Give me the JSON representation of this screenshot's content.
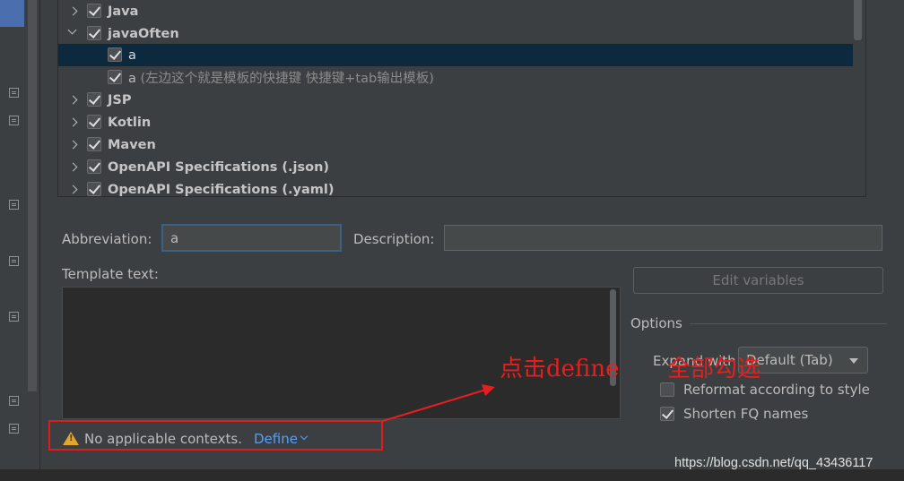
{
  "tree": {
    "rows": [
      {
        "label": "Java",
        "checked": true,
        "expanded": false,
        "level": 0
      },
      {
        "label": "javaOften",
        "checked": true,
        "expanded": true,
        "level": 0
      },
      {
        "label": "a",
        "checked": true,
        "level": 1,
        "selected": true
      },
      {
        "label": "a",
        "desc": " (左边这个就是模板的快捷键  快捷键+tab输出模板)",
        "checked": true,
        "level": 1
      },
      {
        "label": "JSP",
        "checked": true,
        "expanded": false,
        "level": 0
      },
      {
        "label": "Kotlin",
        "checked": true,
        "expanded": false,
        "level": 0
      },
      {
        "label": "Maven",
        "checked": true,
        "expanded": false,
        "level": 0
      },
      {
        "label": "OpenAPI Specifications (.json)",
        "checked": true,
        "expanded": false,
        "level": 0
      },
      {
        "label": "OpenAPI Specifications (.yaml)",
        "checked": true,
        "expanded": false,
        "level": 0
      }
    ]
  },
  "form": {
    "abbreviation_label": "Abbreviation:",
    "abbreviation_value": "a",
    "description_label": "Description:",
    "description_value": "",
    "template_label": "Template text:",
    "edit_variables": "Edit variables"
  },
  "options": {
    "title": "Options",
    "expand_with_label": "Expand with",
    "expand_with_value": "Default (Tab)",
    "reformat_label": "Reformat according to style",
    "reformat_checked": false,
    "shorten_label": "Shorten FQ names",
    "shorten_checked": true
  },
  "context": {
    "warning_text": "No applicable contexts.",
    "define_link": "Define"
  },
  "annotations": {
    "click_define": "点击define",
    "select_all": "全部勾选",
    "color": "#e81e1e"
  },
  "watermark": "https://blog.csdn.net/qq_43436117"
}
